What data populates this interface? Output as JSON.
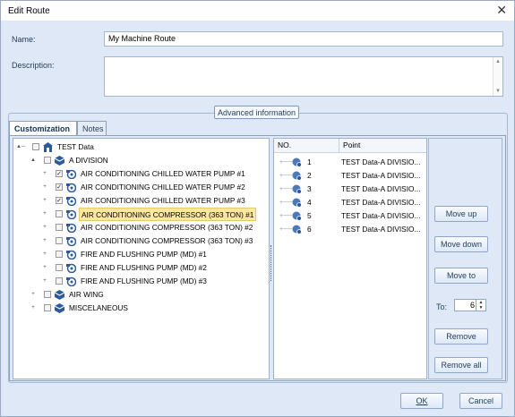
{
  "window": {
    "title": "Edit Route",
    "close_glyph": "✕"
  },
  "form": {
    "name_label": "Name:",
    "name_value": "My Machine Route",
    "description_label": "Description:",
    "description_value": "",
    "advanced_label": "Advanced information"
  },
  "tabs": [
    {
      "label": "Customization",
      "active": true
    },
    {
      "label": "Notes",
      "active": false
    }
  ],
  "tree": {
    "rows": [
      {
        "label": "TEST Data",
        "level": 0,
        "checked": false,
        "icon": "building-icon",
        "expander": "minus"
      },
      {
        "label": "A DIVISION",
        "level": 1,
        "checked": false,
        "icon": "cube-icon",
        "expander": "minus"
      },
      {
        "label": "AIR CONDITIONING CHILLED WATER PUMP #1",
        "level": 2,
        "checked": true,
        "icon": "machine-icon",
        "expander": "plus"
      },
      {
        "label": "AIR CONDITIONING CHILLED WATER PUMP #2",
        "level": 2,
        "checked": true,
        "icon": "machine-icon",
        "expander": "plus"
      },
      {
        "label": "AIR CONDITIONING CHILLED WATER PUMP #3",
        "level": 2,
        "checked": true,
        "icon": "machine-icon",
        "expander": "plus"
      },
      {
        "label": "AIR CONDITIONING COMPRESSOR (363 TON) #1",
        "level": 2,
        "checked": false,
        "icon": "machine-icon",
        "expander": "plus",
        "selected": true
      },
      {
        "label": "AIR CONDITIONING COMPRESSOR (363 TON) #2",
        "level": 2,
        "checked": false,
        "icon": "machine-icon",
        "expander": "plus"
      },
      {
        "label": "AIR CONDITIONING COMPRESSOR (363 TON) #3",
        "level": 2,
        "checked": false,
        "icon": "machine-icon",
        "expander": "plus"
      },
      {
        "label": "FIRE AND FLUSHING PUMP (MD) #1",
        "level": 2,
        "checked": false,
        "icon": "machine-icon",
        "expander": "plus"
      },
      {
        "label": "FIRE AND FLUSHING PUMP (MD) #2",
        "level": 2,
        "checked": false,
        "icon": "machine-icon",
        "expander": "plus"
      },
      {
        "label": "FIRE AND FLUSHING PUMP (MD) #3",
        "level": 2,
        "checked": false,
        "icon": "machine-icon",
        "expander": "plus"
      },
      {
        "label": "AIR WING",
        "level": 1,
        "checked": false,
        "icon": "cube-icon",
        "expander": "plus"
      },
      {
        "label": "MISCELANEOUS",
        "level": 1,
        "checked": false,
        "icon": "cube-icon",
        "expander": "plus"
      }
    ]
  },
  "grid": {
    "col_no": "NO.",
    "col_point": "Point",
    "rows": [
      {
        "no": "1",
        "point": "TEST Data-A DIVISIO..."
      },
      {
        "no": "2",
        "point": "TEST Data-A DIVISIO..."
      },
      {
        "no": "3",
        "point": "TEST Data-A DIVISIO..."
      },
      {
        "no": "4",
        "point": "TEST Data-A DIVISIO..."
      },
      {
        "no": "5",
        "point": "TEST Data-A DIVISIO..."
      },
      {
        "no": "6",
        "point": "TEST Data-A DIVISIO..."
      }
    ]
  },
  "buttons": {
    "move_up": "Move up",
    "move_down": "Move down",
    "move_to": "Move to",
    "to_label": "To:",
    "to_value": "6",
    "remove": "Remove",
    "remove_all": "Remove all"
  },
  "footer": {
    "ok": "OK",
    "cancel": "Cancel"
  },
  "colors": {
    "accent": "#1f3c5a",
    "selection": "#fde89b",
    "panel": "#dfe8f6"
  }
}
